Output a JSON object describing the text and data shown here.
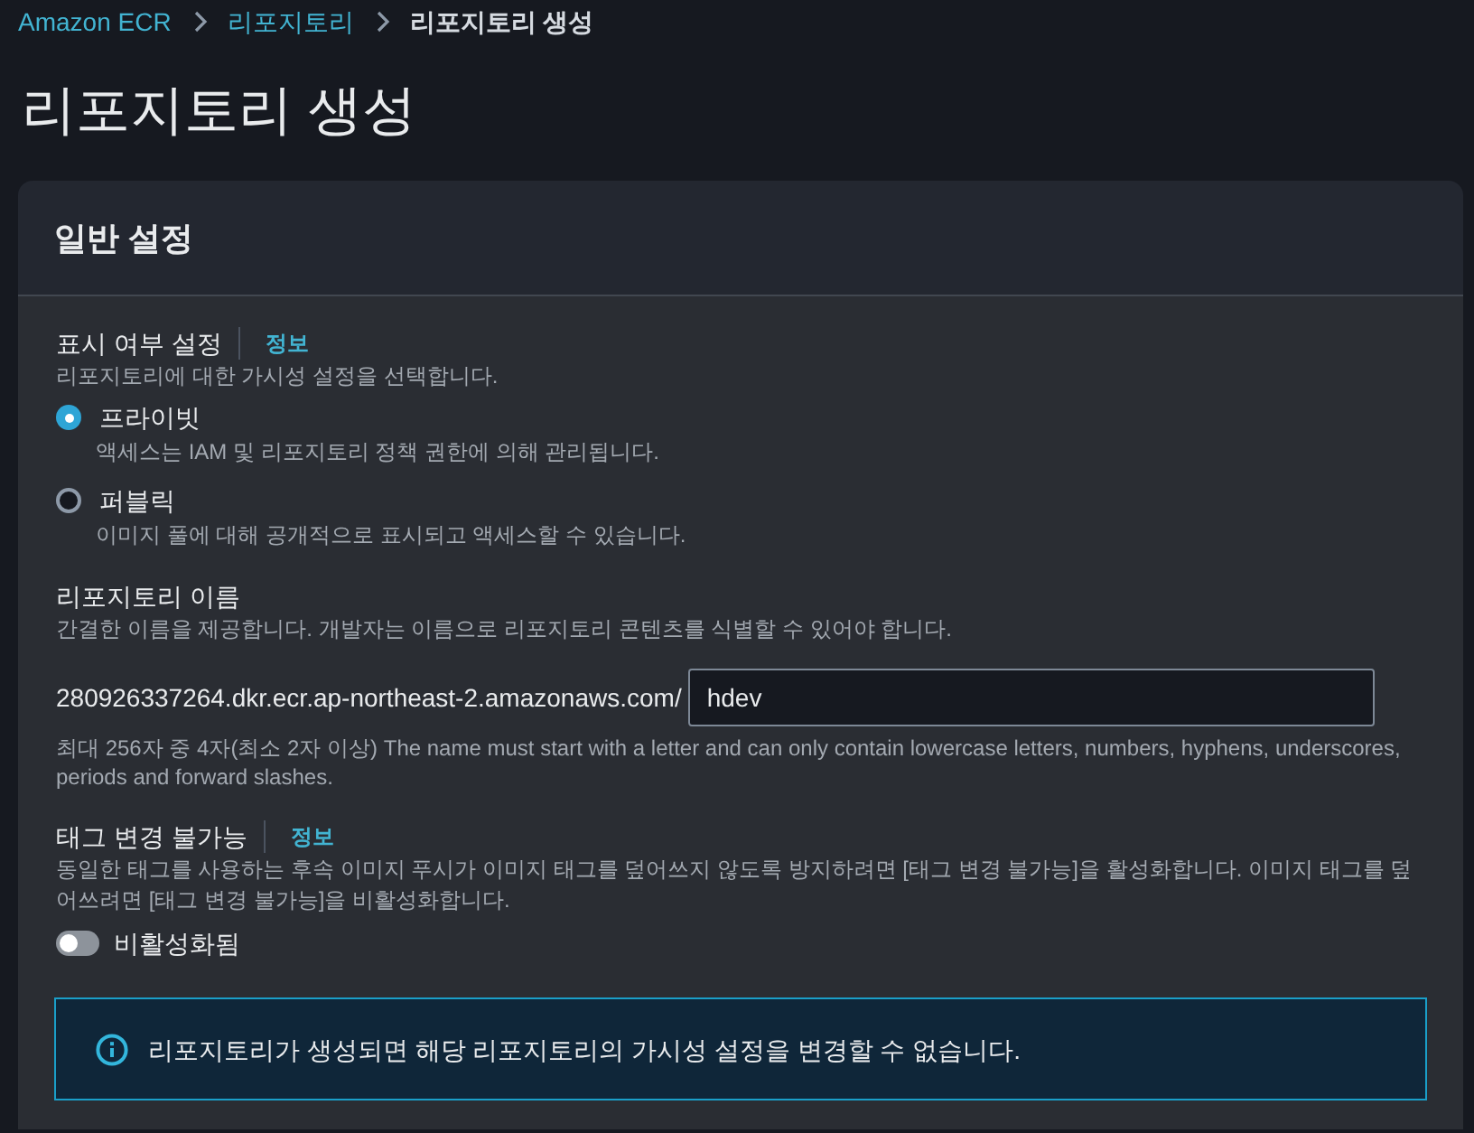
{
  "breadcrumbs": [
    {
      "label": "Amazon ECR",
      "kind": "link"
    },
    {
      "label": "리포지토리",
      "kind": "link"
    },
    {
      "label": "리포지토리 생성",
      "kind": "current"
    }
  ],
  "page_title": "리포지토리 생성",
  "panel": {
    "title": "일반 설정",
    "sections": [
      {
        "kind": "radio_group",
        "label": "표시 여부 설정",
        "info": "정보",
        "description": "리포지토리에 대한 가시성 설정을 선택합니다.",
        "options": [
          {
            "label": "프라이빗",
            "description": "액세스는 IAM 및 리포지토리 정책 권한에 의해 관리됩니다.",
            "selected": true
          },
          {
            "label": "퍼블릭",
            "description": "이미지 풀에 대해 공개적으로 표시되고 액세스할 수 있습니다.",
            "selected": false
          }
        ]
      },
      {
        "kind": "text_input",
        "label": "리포지토리 이름",
        "description": "간결한 이름을 제공합니다. 개발자는 이름으로 리포지토리 콘텐츠를 식별할 수 있어야 합니다.",
        "prefix": "280926337264.dkr.ecr.ap-northeast-2.amazonaws.com/",
        "value": "hdev",
        "hint": "최대 256자 중 4자(최소 2자 이상) The name must start with a letter and can only contain lowercase letters, numbers, hyphens, underscores, periods and forward slashes."
      },
      {
        "kind": "toggle",
        "label": "태그 변경 불가능",
        "info": "정보",
        "description": "동일한 태그를 사용하는 후속 이미지 푸시가 이미지 태그를 덮어쓰지 않도록 방지하려면 [태그 변경 불가능]을 활성화합니다. 이미지 태그를 덮어쓰려면 [태그 변경 불가능]을 비활성화합니다.",
        "on": false,
        "state_label": "비활성화됨"
      }
    ],
    "alert": {
      "text": "리포지토리가 생성되면 해당 리포지토리의 가시성 설정을 변경할 수 없습니다."
    }
  }
}
